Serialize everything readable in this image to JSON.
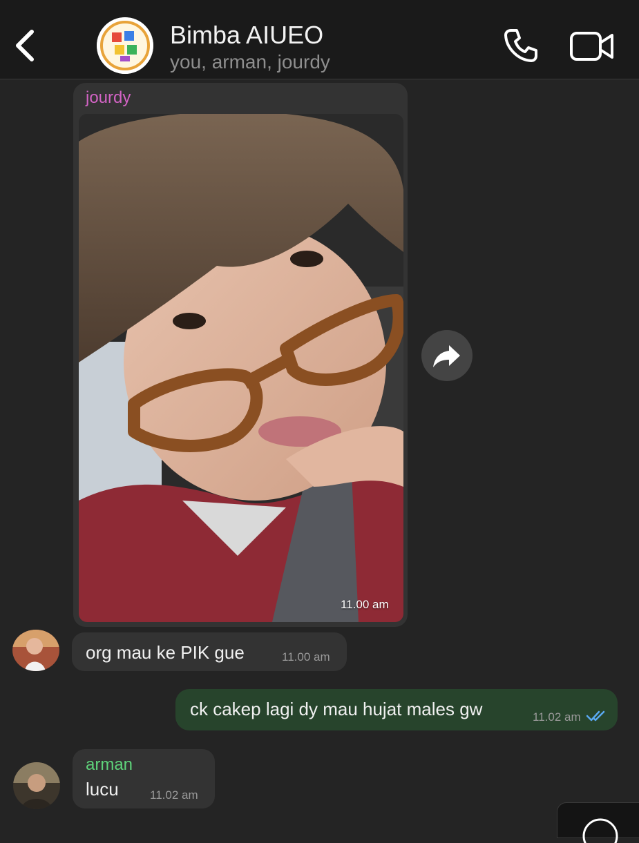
{
  "header": {
    "title": "Bimba AIUEO",
    "members": "you, arman, jourdy"
  },
  "messages": [
    {
      "sender": "jourdy",
      "type": "image",
      "time": "11.00 am"
    },
    {
      "type": "text",
      "text": "org mau ke PIK gue",
      "time": "11.00 am"
    },
    {
      "type": "text",
      "outgoing": true,
      "text": "ck cakep lagi dy mau hujat males gw",
      "time": "11.02 am",
      "status": "read"
    },
    {
      "sender": "arman",
      "type": "text",
      "text": "lucu",
      "time": "11.02 am"
    }
  ],
  "colors": {
    "background": "#242424",
    "header": "#1a1a1a",
    "incoming_bubble": "#333333",
    "outgoing_bubble": "#27442c",
    "sender_jourdy": "#d263c4",
    "sender_arman": "#5ed37a",
    "read_ticks": "#5aa9f2"
  },
  "icons": {
    "back": "chevron-left-icon",
    "call": "phone-icon",
    "video": "video-camera-icon",
    "forward": "forward-arrow-icon",
    "read": "double-check-icon"
  }
}
